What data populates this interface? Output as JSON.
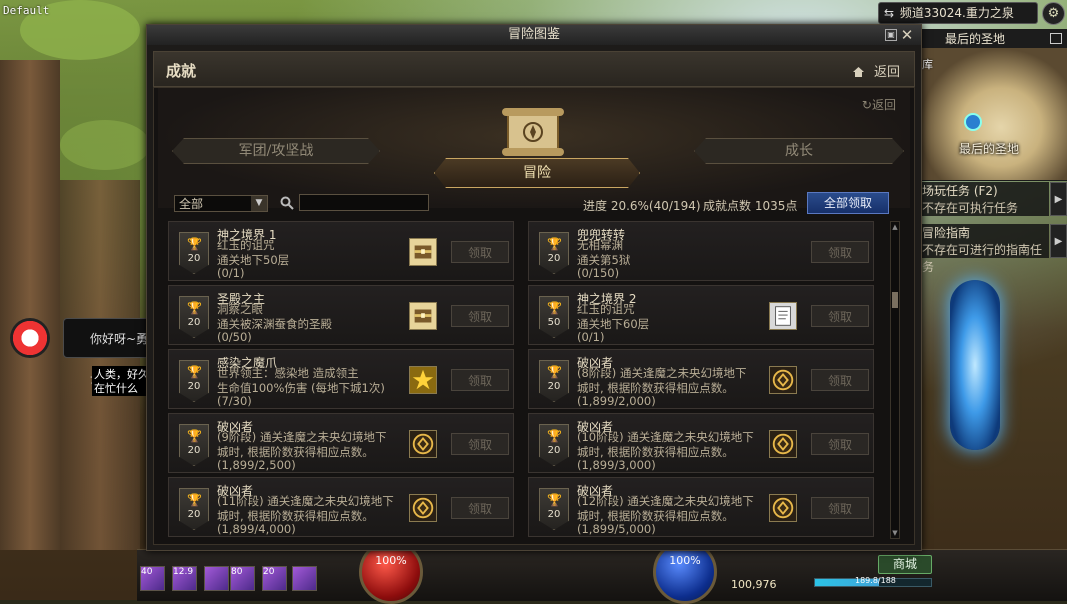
{
  "scene": {
    "default_label": "Default",
    "channel": "频道33024.重力之泉",
    "minimap_title": "最后的圣地",
    "minimap_place": "最后的圣地",
    "minimap_lib": "库",
    "side_panels": [
      {
        "title": "场玩任务 (F2)",
        "sub": "不存在可执行任务"
      },
      {
        "title": "冒险指南",
        "sub": "不存在可进行的指南任务"
      }
    ],
    "chat_text": "你好呀~勇士",
    "npc_talk": "人类，好久 在忙什么",
    "hp_text": "100%",
    "mp_text": "100%",
    "gold": "100,976",
    "shop_label": "商城",
    "exp_text": "189.8/188",
    "exp_fraction": 0.55,
    "hud_slots": [
      "40",
      "12.9",
      "",
      "80",
      "20",
      ""
    ]
  },
  "window": {
    "title": "冒险图鉴",
    "header_title": "成就",
    "header_back": "返回",
    "small_back": "返回",
    "categories": [
      "军团/攻坚战",
      "冒险",
      "成长"
    ],
    "filter_value": "全部",
    "search_placeholder": "",
    "progress": "进度 20.6%(40/194)",
    "points": "成就点数 1035点",
    "claim_all": "全部领取"
  },
  "achievements": [
    {
      "title": "神之境界 1",
      "line2": "红玉的诅咒",
      "line3": "通关地下50层",
      "progress": "(0/1)",
      "points": "20",
      "reward": "chest-icon",
      "claim": "领取"
    },
    {
      "title": "兜兜转转",
      "line2": "无相幂渊",
      "line3": "通关第5狱",
      "progress": "(0/150)",
      "points": "20",
      "reward": "",
      "claim": "领取"
    },
    {
      "title": "圣殿之主",
      "line2": "洞察之眼",
      "line3": "通关被深渊蚕食的圣殿",
      "progress": "(0/50)",
      "points": "20",
      "reward": "chest-icon",
      "claim": "领取"
    },
    {
      "title": "神之境界 2",
      "line2": "红玉的诅咒",
      "line3": "通关地下60层",
      "progress": "(0/1)",
      "points": "50",
      "reward": "scroll-icon",
      "claim": "领取"
    },
    {
      "title": "感染之魔爪",
      "line2": "世界领主：感染地        造成领主",
      "line3": "生命值100%伤害 (每地下城1次)",
      "progress": "(7/30)",
      "points": "20",
      "reward": "star-icon",
      "claim": "领取"
    },
    {
      "title": "破凶者",
      "line2": "(8阶段) 通关逢魔之未央幻境地下",
      "line3": "城时, 根据阶数获得相应点数。",
      "progress": "(1,899/2,000)",
      "points": "20",
      "reward": "emblem-icon",
      "claim": "领取"
    },
    {
      "title": "破凶者",
      "line2": "(9阶段) 通关逢魔之未央幻境地下",
      "line3": "城时, 根据阶数获得相应点数。",
      "progress": "(1,899/2,500)",
      "points": "20",
      "reward": "emblem-icon",
      "claim": "领取"
    },
    {
      "title": "破凶者",
      "line2": "(10阶段) 通关逢魔之未央幻境地下",
      "line3": "城时, 根据阶数获得相应点数。",
      "progress": "(1,899/3,000)",
      "points": "20",
      "reward": "emblem-icon",
      "claim": "领取"
    },
    {
      "title": "破凶者",
      "line2": "(11阶段) 通关逢魔之未央幻境地下",
      "line3": "城时, 根据阶数获得相应点数。",
      "progress": "(1,899/4,000)",
      "points": "20",
      "reward": "emblem-icon",
      "claim": "领取"
    },
    {
      "title": "破凶者",
      "line2": "(12阶段) 通关逢魔之未央幻境地下",
      "line3": "城时, 根据阶数获得相应点数。",
      "progress": "(1,899/5,000)",
      "points": "20",
      "reward": "emblem-icon",
      "claim": "领取"
    }
  ]
}
